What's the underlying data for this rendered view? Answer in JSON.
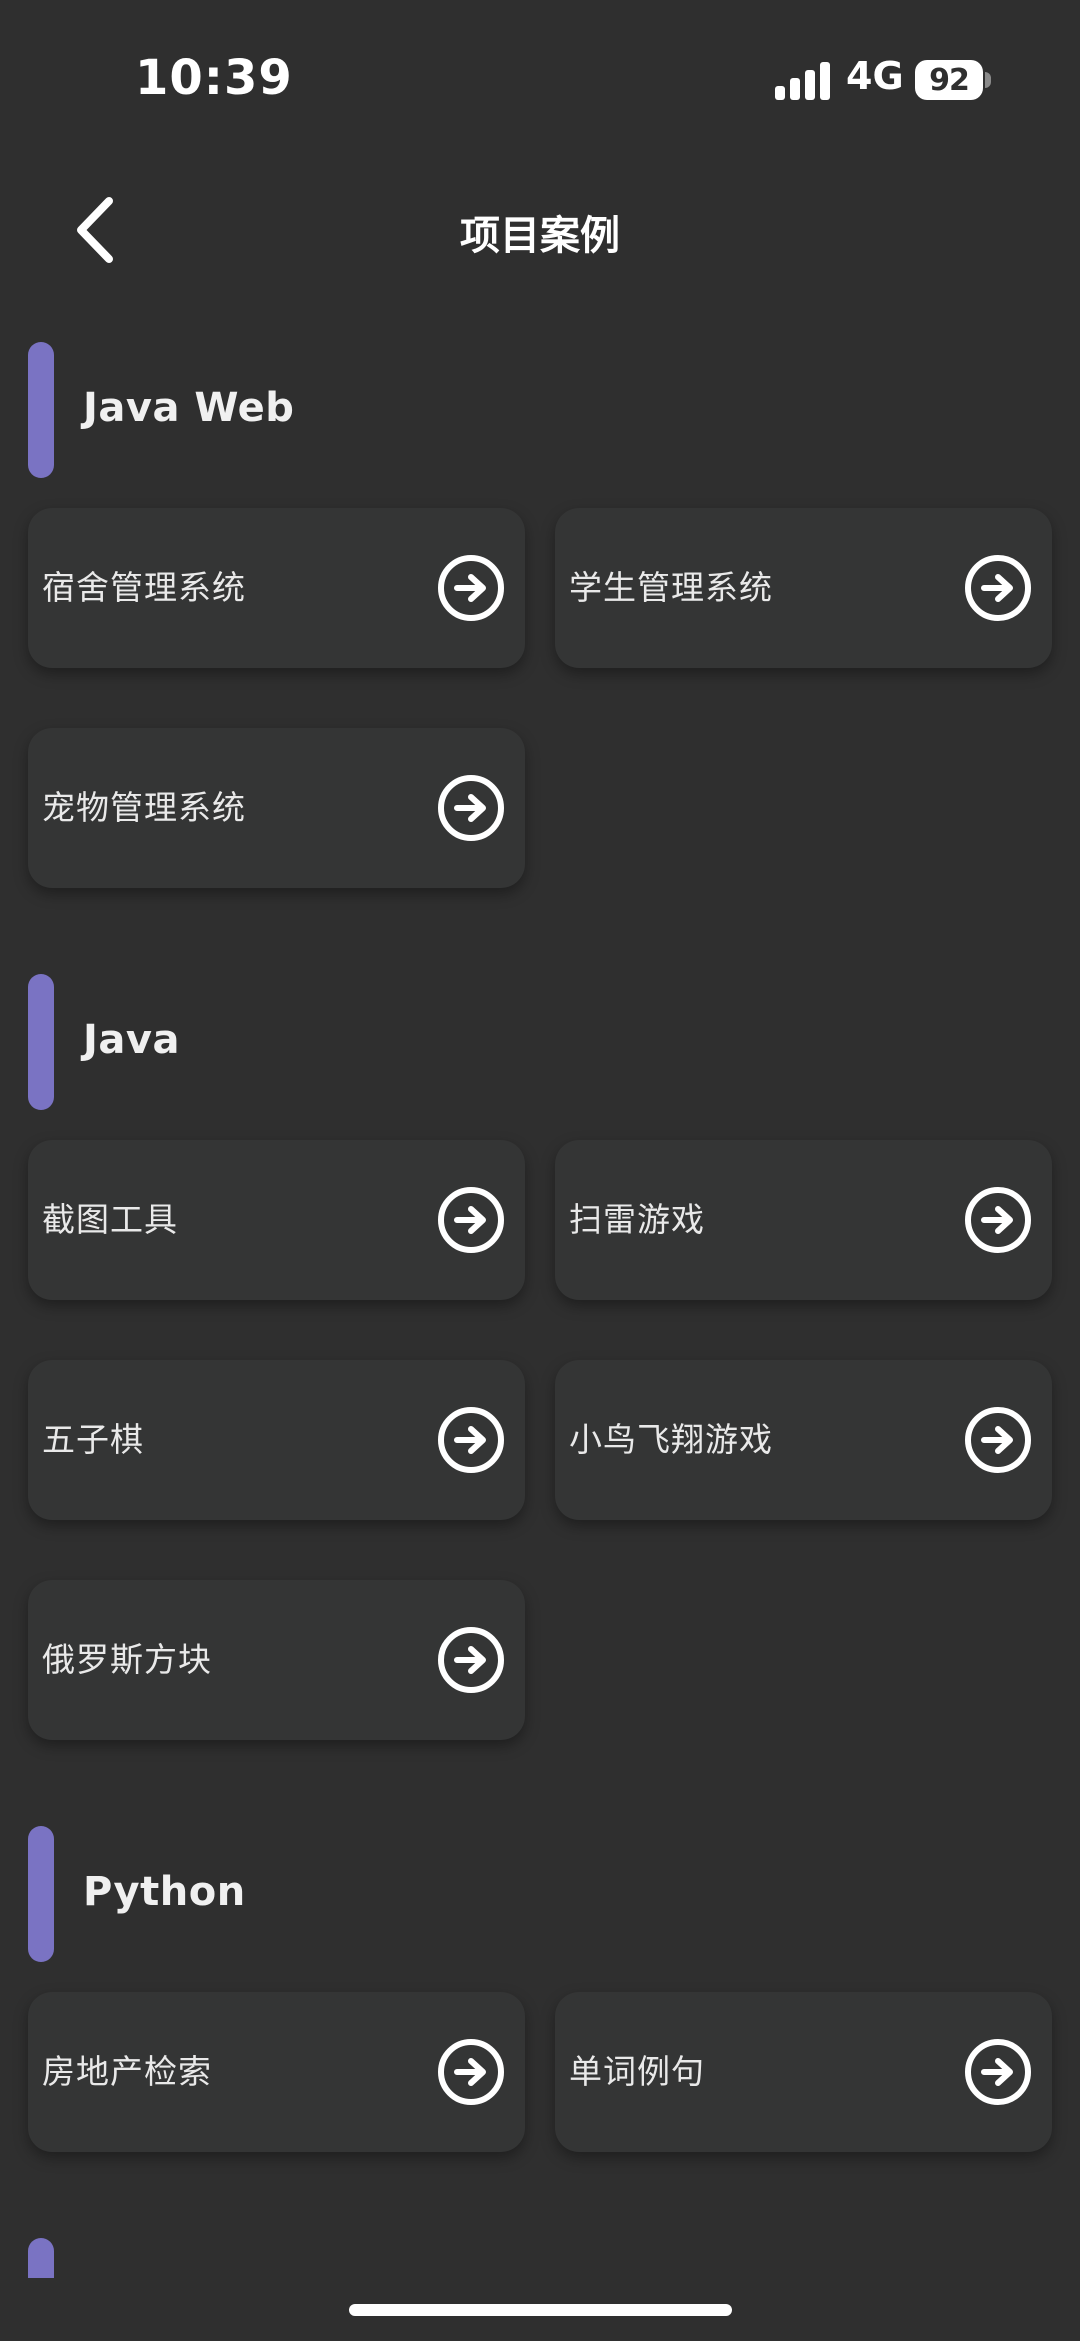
{
  "status_bar": {
    "time": "10:39",
    "network": "4G",
    "battery": "92"
  },
  "header": {
    "title": "项目案例",
    "back_icon": "chevron-left-icon"
  },
  "accent_color": "#7a73c3",
  "sections": [
    {
      "title": "Java Web",
      "items": [
        "宿舍管理系统",
        "学生管理系统",
        "宠物管理系统"
      ]
    },
    {
      "title": "Java",
      "items": [
        "截图工具",
        "扫雷游戏",
        "五子棋",
        "小鸟飞翔游戏",
        "俄罗斯方块"
      ]
    },
    {
      "title": "Python",
      "items": [
        "房地产检索",
        "单词例句"
      ]
    }
  ],
  "card_icon": "arrow-right-circle-icon"
}
